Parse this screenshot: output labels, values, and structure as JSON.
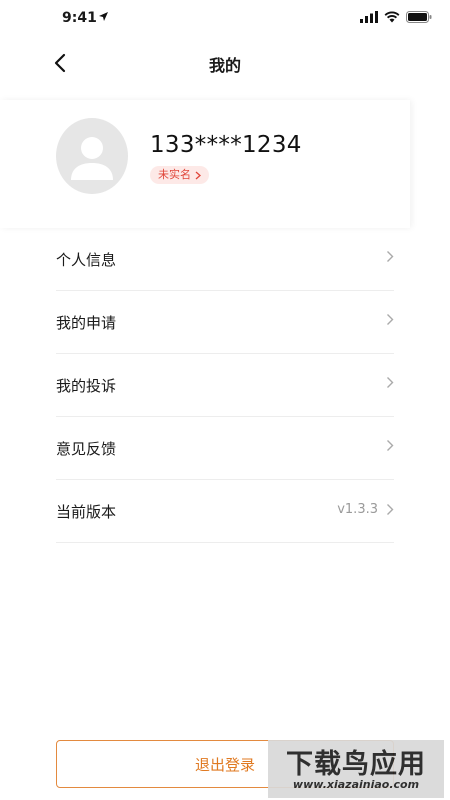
{
  "status_bar": {
    "time": "9:41"
  },
  "nav": {
    "title": "我的"
  },
  "profile": {
    "phone": "133****1234",
    "badge_label": "未实名"
  },
  "menu": [
    {
      "label": "个人信息",
      "value": ""
    },
    {
      "label": "我的申请",
      "value": ""
    },
    {
      "label": "我的投诉",
      "value": ""
    },
    {
      "label": "意见反馈",
      "value": ""
    },
    {
      "label": "当前版本",
      "value": "v1.3.3"
    }
  ],
  "logout": {
    "label": "退出登录"
  },
  "watermark": {
    "title": "下载鸟应用",
    "url": "www.xiazainiao.com"
  },
  "colors": {
    "accent": "#e07a22",
    "badge_text": "#e0463a",
    "badge_bg": "#fde9e7",
    "divider": "#ededed"
  }
}
